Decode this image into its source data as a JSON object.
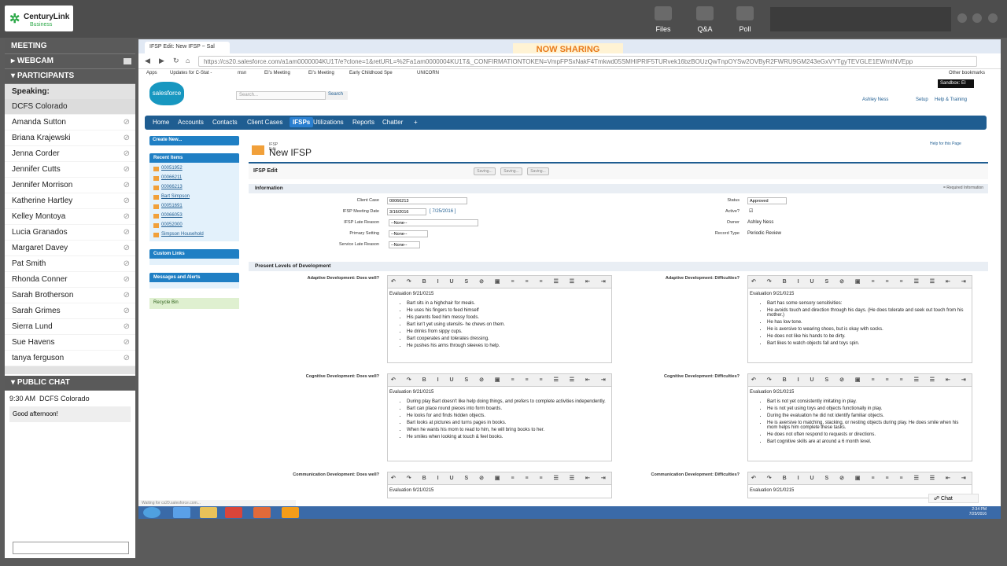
{
  "app": {
    "logo_top": "CenturyLink",
    "logo_bottom": "Business",
    "files": "Files",
    "qa": "Q&A",
    "poll": "Poll"
  },
  "left": {
    "meeting": "MEETING",
    "webcam": "WEBCAM",
    "participants": "PARTICIPANTS",
    "speaking": "Speaking:",
    "people": [
      "DCFS Colorado",
      "Amanda Sutton",
      "Briana Krajewski",
      "Jenna Corder",
      "Jennifer Cutts",
      "Jennifer Morrison",
      "Katherine Hartley",
      "Kelley Montoya",
      "Lucia Granados",
      "Margaret Davey",
      "Pat Smith",
      "Rhonda Conner",
      "Sarah Brotherson",
      "Sarah Grimes",
      "Sierra Lund",
      "Sue Havens",
      "tanya ferguson"
    ],
    "public_chat": "PUBLIC CHAT",
    "chat_time": "9:30 AM",
    "chat_sender": "DCFS Colorado",
    "chat_msg": "Good afternoon!"
  },
  "browser": {
    "tab": "IFSP Edit: New IFSP ~ Sal",
    "now_sharing": "NOW SHARING",
    "url": "https://cs20.salesforce.com/a1am0000004KU1T/e?clone=1&retURL=%2Fa1am0000004KU1T&_CONFIRMATIONTOKEN=VmpFPSxNakF4Tmkwd05SMHIPRlF5TURvek16bzBOUzQwTnpOYSw2OVByR2FWRU9GM243eGxVYTgyTEVGLE1EWmtNVEpp",
    "bookmarks": [
      "Apps",
      "Updates for C-Stat -",
      "msn",
      "EI's Meeting",
      "EI's Meeting",
      "Early Childhood Spe",
      "UNICORN"
    ],
    "other_bm": "Other bookmarks"
  },
  "sf": {
    "search_placeholder": "Search...",
    "search_btn": "Search",
    "user": "Ashley Ness",
    "setup": "Setup",
    "help": "Help & Training",
    "sandbox": "Sandbox: EI",
    "tabs": [
      "Home",
      "Accounts",
      "Contacts",
      "Client Cases",
      "IFSPs",
      "Utilizations",
      "Reports",
      "Chatter",
      "+"
    ],
    "create_new": "Create New...",
    "recent_items": "Recent Items",
    "recent": [
      "00051952",
      "00066211",
      "00066213",
      "Bart Simpson",
      "00051691",
      "00066053",
      "00052000",
      "Simpson Household"
    ],
    "custom_links": "Custom Links",
    "messages": "Messages and Alerts",
    "recycle": "Recycle Bin",
    "small_title": "IFSP Edit",
    "title": "New IFSP",
    "help_page": "Help for this Page",
    "edit_label": "IFSP Edit",
    "saving": "Saving...",
    "info": "Information",
    "required": "= Required Information",
    "fields": {
      "client_case_l": "Client Case",
      "client_case": "00066213",
      "meeting_date_l": "IFSP Meeting Date",
      "meeting_date": "3/16/2016",
      "meeting_date_link": "[ 7/25/2016 ]",
      "late_reason_l": "IFSP Late Reason",
      "late_reason": "--None--",
      "primary_l": "Primary Setting",
      "primary": "--None--",
      "service_late_l": "Service Late Reason",
      "service_late": "--None--",
      "status_l": "Status",
      "status": "Approved",
      "active_l": "Active?",
      "owner_l": "Owner",
      "owner": "Ashley Ness",
      "record_l": "Record Type",
      "record": "Periodic Review"
    },
    "plod": "Present Levels of Development",
    "adaptive_well_l": "Adaptive Development: Does well?",
    "adaptive_diff_l": "Adaptive Development: Difficulties?",
    "cognitive_well_l": "Cognitive Development: Does well?",
    "cognitive_diff_l": "Cognitive Development: Difficulties?",
    "comm_well_l": "Communication Development: Does well?",
    "comm_diff_l": "Communication Development: Difficulties?",
    "eval": "Evaluation 9/21/0215",
    "adaptive_well": [
      "Bart sits in a highchair for meals.",
      "He uses his fingers to feed himself",
      "His parents feed him messy foods.",
      "Bart isn't yet using utensils- he chews on them.",
      "He drinks from sippy cups.",
      "Bart cooperates and tolerates dressing.",
      "He pushes his arms through sleeves to help."
    ],
    "adaptive_diff": [
      "Bart has some sensory sensitivities:",
      "He avoids touch and direction through his days. (He does tolerate and seek out touch from his mother.)",
      "He has low tone.",
      "He is aversive to wearing shoes, but is okay with socks.",
      "He does not like his hands to be dirty.",
      "Bart likes to watch objects fall and toys spin."
    ],
    "cognitive_well": [
      "During play Bart doesn't like help doing things, and prefers to complete activities independently.",
      "Bart can place round pieces into form boards.",
      "He looks for and finds hidden objects.",
      "Bart looks at pictures and turns pages in books.",
      "When he wants his mom to read to him, he will bring books to her.",
      "He smiles when looking at touch & feel books."
    ],
    "cognitive_diff": [
      "Bart is not yet consistently imitating in play.",
      "He is not yet using toys and objects functionally in play.",
      "During the evaluation he did not identify familiar objects.",
      "He is aversive to matching, stacking, or nesting objects during play. He does smile when his mom helps him complete these tasks.",
      "He does not often respond to requests or directions.",
      "Bart cognitive skills are at around a 6 month level."
    ],
    "comm_eval": "Evaluation 9/21/0215",
    "status_bar": "Waiting for cs20.salesforce.com...",
    "chat": "Chat"
  },
  "clock": {
    "time": "2:34 PM",
    "date": "7/25/2016"
  },
  "toolbar_glyphs": "↶ ↷ B I U S ⊘ ▣ ≡ ≡ ≡ ☰ ☰ ⇤ ⇥"
}
